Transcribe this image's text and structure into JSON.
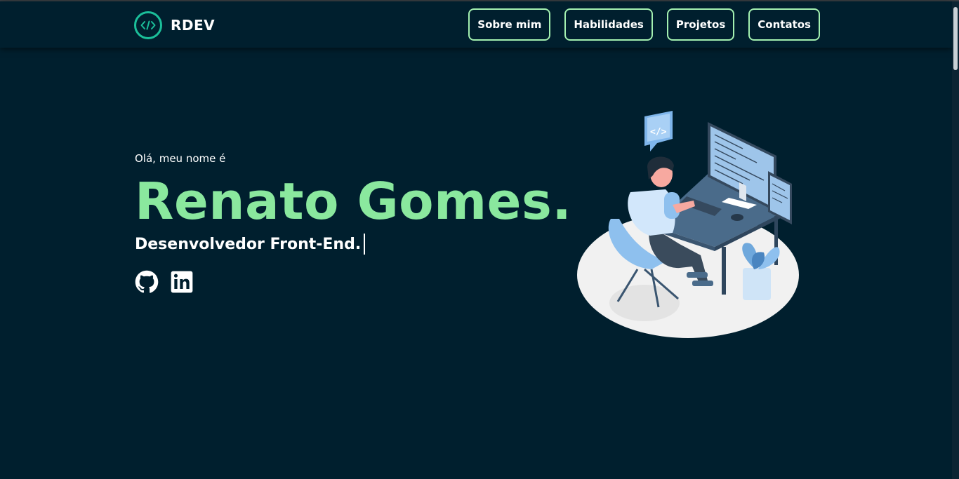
{
  "nav": {
    "brand": "RDEV",
    "logo_icon": "code-icon",
    "links": [
      "Sobre mim",
      "Habilidades",
      "Projetos",
      "Contatos"
    ]
  },
  "hero": {
    "greeting": "Olá, meu nome é",
    "name": "Renato Gomes.",
    "role": "Desenvolvedor Front-End.",
    "socials": [
      "github-icon",
      "linkedin-icon"
    ]
  },
  "colors": {
    "background": "#001f2e",
    "accent": "#8ae89e",
    "button_border": "#a3f0b0",
    "logo_ring": "#1bbf9a"
  }
}
